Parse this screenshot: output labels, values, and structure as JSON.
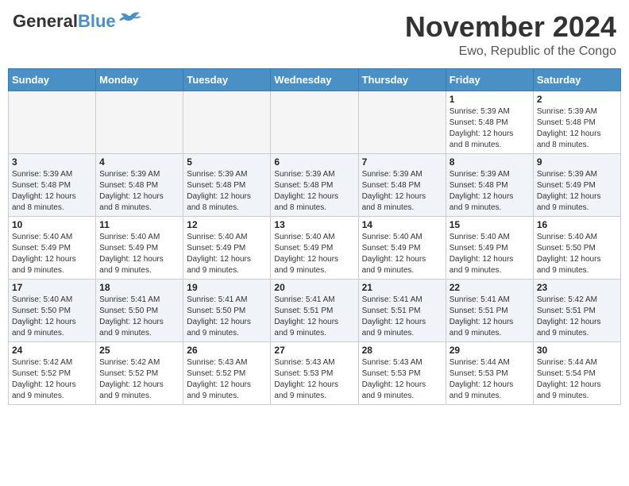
{
  "header": {
    "logo_line1": "General",
    "logo_line2": "Blue",
    "month": "November 2024",
    "location": "Ewo, Republic of the Congo"
  },
  "days_of_week": [
    "Sunday",
    "Monday",
    "Tuesday",
    "Wednesday",
    "Thursday",
    "Friday",
    "Saturday"
  ],
  "weeks": [
    [
      {
        "day": "",
        "info": ""
      },
      {
        "day": "",
        "info": ""
      },
      {
        "day": "",
        "info": ""
      },
      {
        "day": "",
        "info": ""
      },
      {
        "day": "",
        "info": ""
      },
      {
        "day": "1",
        "info": "Sunrise: 5:39 AM\nSunset: 5:48 PM\nDaylight: 12 hours\nand 8 minutes."
      },
      {
        "day": "2",
        "info": "Sunrise: 5:39 AM\nSunset: 5:48 PM\nDaylight: 12 hours\nand 8 minutes."
      }
    ],
    [
      {
        "day": "3",
        "info": "Sunrise: 5:39 AM\nSunset: 5:48 PM\nDaylight: 12 hours\nand 8 minutes."
      },
      {
        "day": "4",
        "info": "Sunrise: 5:39 AM\nSunset: 5:48 PM\nDaylight: 12 hours\nand 8 minutes."
      },
      {
        "day": "5",
        "info": "Sunrise: 5:39 AM\nSunset: 5:48 PM\nDaylight: 12 hours\nand 8 minutes."
      },
      {
        "day": "6",
        "info": "Sunrise: 5:39 AM\nSunset: 5:48 PM\nDaylight: 12 hours\nand 8 minutes."
      },
      {
        "day": "7",
        "info": "Sunrise: 5:39 AM\nSunset: 5:48 PM\nDaylight: 12 hours\nand 8 minutes."
      },
      {
        "day": "8",
        "info": "Sunrise: 5:39 AM\nSunset: 5:48 PM\nDaylight: 12 hours\nand 9 minutes."
      },
      {
        "day": "9",
        "info": "Sunrise: 5:39 AM\nSunset: 5:49 PM\nDaylight: 12 hours\nand 9 minutes."
      }
    ],
    [
      {
        "day": "10",
        "info": "Sunrise: 5:40 AM\nSunset: 5:49 PM\nDaylight: 12 hours\nand 9 minutes."
      },
      {
        "day": "11",
        "info": "Sunrise: 5:40 AM\nSunset: 5:49 PM\nDaylight: 12 hours\nand 9 minutes."
      },
      {
        "day": "12",
        "info": "Sunrise: 5:40 AM\nSunset: 5:49 PM\nDaylight: 12 hours\nand 9 minutes."
      },
      {
        "day": "13",
        "info": "Sunrise: 5:40 AM\nSunset: 5:49 PM\nDaylight: 12 hours\nand 9 minutes."
      },
      {
        "day": "14",
        "info": "Sunrise: 5:40 AM\nSunset: 5:49 PM\nDaylight: 12 hours\nand 9 minutes."
      },
      {
        "day": "15",
        "info": "Sunrise: 5:40 AM\nSunset: 5:49 PM\nDaylight: 12 hours\nand 9 minutes."
      },
      {
        "day": "16",
        "info": "Sunrise: 5:40 AM\nSunset: 5:50 PM\nDaylight: 12 hours\nand 9 minutes."
      }
    ],
    [
      {
        "day": "17",
        "info": "Sunrise: 5:40 AM\nSunset: 5:50 PM\nDaylight: 12 hours\nand 9 minutes."
      },
      {
        "day": "18",
        "info": "Sunrise: 5:41 AM\nSunset: 5:50 PM\nDaylight: 12 hours\nand 9 minutes."
      },
      {
        "day": "19",
        "info": "Sunrise: 5:41 AM\nSunset: 5:50 PM\nDaylight: 12 hours\nand 9 minutes."
      },
      {
        "day": "20",
        "info": "Sunrise: 5:41 AM\nSunset: 5:51 PM\nDaylight: 12 hours\nand 9 minutes."
      },
      {
        "day": "21",
        "info": "Sunrise: 5:41 AM\nSunset: 5:51 PM\nDaylight: 12 hours\nand 9 minutes."
      },
      {
        "day": "22",
        "info": "Sunrise: 5:41 AM\nSunset: 5:51 PM\nDaylight: 12 hours\nand 9 minutes."
      },
      {
        "day": "23",
        "info": "Sunrise: 5:42 AM\nSunset: 5:51 PM\nDaylight: 12 hours\nand 9 minutes."
      }
    ],
    [
      {
        "day": "24",
        "info": "Sunrise: 5:42 AM\nSunset: 5:52 PM\nDaylight: 12 hours\nand 9 minutes."
      },
      {
        "day": "25",
        "info": "Sunrise: 5:42 AM\nSunset: 5:52 PM\nDaylight: 12 hours\nand 9 minutes."
      },
      {
        "day": "26",
        "info": "Sunrise: 5:43 AM\nSunset: 5:52 PM\nDaylight: 12 hours\nand 9 minutes."
      },
      {
        "day": "27",
        "info": "Sunrise: 5:43 AM\nSunset: 5:53 PM\nDaylight: 12 hours\nand 9 minutes."
      },
      {
        "day": "28",
        "info": "Sunrise: 5:43 AM\nSunset: 5:53 PM\nDaylight: 12 hours\nand 9 minutes."
      },
      {
        "day": "29",
        "info": "Sunrise: 5:44 AM\nSunset: 5:53 PM\nDaylight: 12 hours\nand 9 minutes."
      },
      {
        "day": "30",
        "info": "Sunrise: 5:44 AM\nSunset: 5:54 PM\nDaylight: 12 hours\nand 9 minutes."
      }
    ]
  ]
}
